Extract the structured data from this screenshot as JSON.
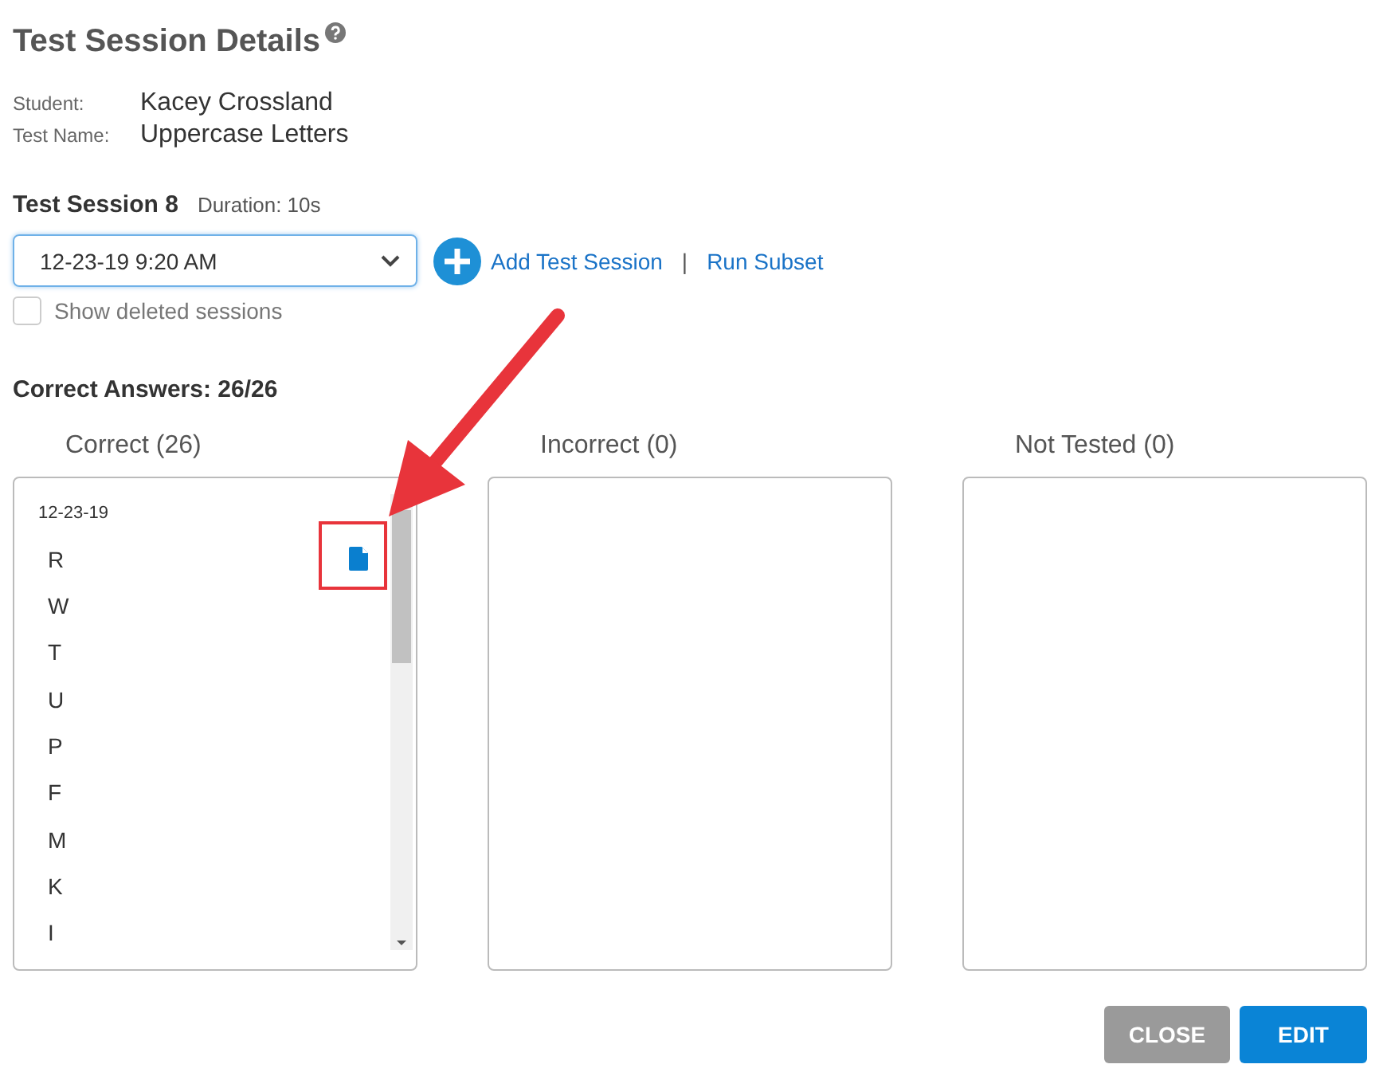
{
  "title": "Test Session Details",
  "info": [
    {
      "label": "Student:",
      "value": "Kacey Crossland"
    },
    {
      "label": "Test Name:",
      "value": "Uppercase Letters"
    }
  ],
  "session": {
    "name": "Test Session 8",
    "duration": "Duration: 10s",
    "selected_date": "12-23-19 9:20 AM",
    "add_link": "Add Test Session",
    "separator": "|",
    "subset_link": "Run Subset",
    "show_deleted": {
      "label": "Show deleted sessions",
      "checked": false
    }
  },
  "summary": "Correct Answers: 26/26",
  "columns": [
    {
      "title": "Correct (26)",
      "date": "12-23-19",
      "items": [
        {
          "letter": "R",
          "note": true
        },
        {
          "letter": "W",
          "note": false
        },
        {
          "letter": "T",
          "note": false
        },
        {
          "letter": "U",
          "note": false
        },
        {
          "letter": "P",
          "note": false
        },
        {
          "letter": "F",
          "note": false
        },
        {
          "letter": "M",
          "note": false
        },
        {
          "letter": "K",
          "note": false
        },
        {
          "letter": "I",
          "note": false
        }
      ]
    },
    {
      "title": "Incorrect (0)"
    },
    {
      "title": "Not Tested (0)"
    }
  ],
  "buttons": [
    {
      "label": "CLOSE",
      "kind": "secondary"
    },
    {
      "label": "EDIT",
      "kind": "primary"
    }
  ]
}
